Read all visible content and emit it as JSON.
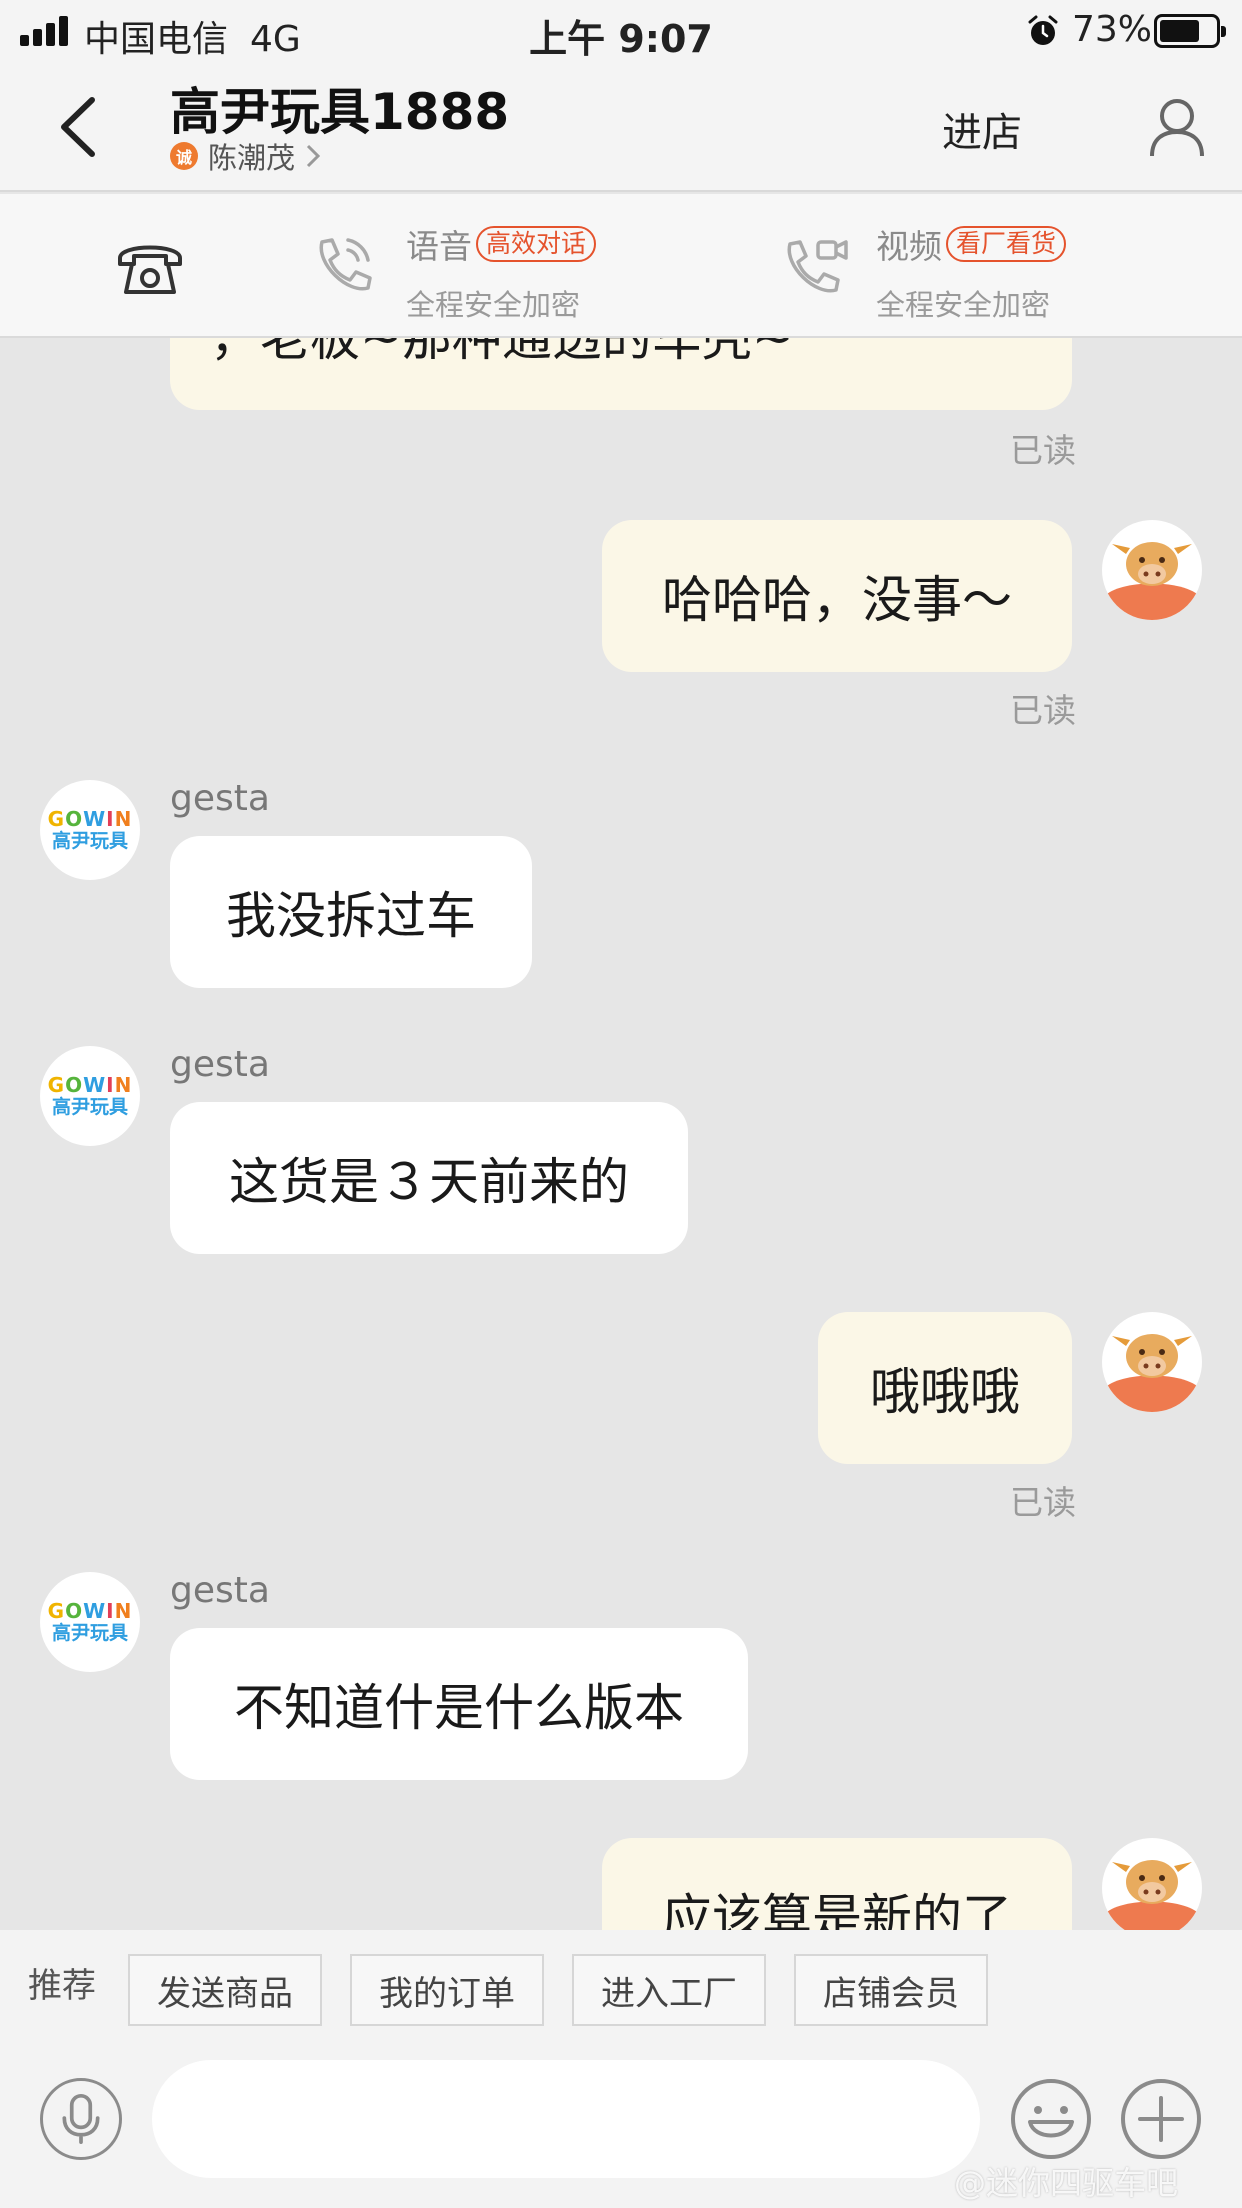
{
  "status_bar": {
    "carrier": "中国电信",
    "network": "4G",
    "time": "上午 9:07",
    "battery_percent": "73%",
    "battery_level": 0.73
  },
  "header": {
    "shop_name": "高尹玩具1888",
    "badge_char": "诚",
    "contact_name": "陈潮茂",
    "enter_store": "进店"
  },
  "call_bar": {
    "voice": {
      "title": "语音",
      "tag": "高效对话",
      "subtitle": "全程安全加密"
    },
    "video": {
      "title": "视频",
      "tag": "看厂看货",
      "subtitle": "全程安全加密"
    }
  },
  "messages": [
    {
      "from": "me",
      "text": "，老板~那种通透的车壳~",
      "read": "已读"
    },
    {
      "from": "me",
      "text": "哈哈哈，没事～",
      "read": "已读"
    },
    {
      "from": "them",
      "sender": "gesta",
      "text": "我没拆过车"
    },
    {
      "from": "them",
      "sender": "gesta",
      "text": "这货是３天前来的"
    },
    {
      "from": "me",
      "text": "哦哦哦",
      "read": "已读"
    },
    {
      "from": "them",
      "sender": "gesta",
      "text": "不知道什是什么版本"
    },
    {
      "from": "me",
      "text": "应该算是新的了"
    }
  ],
  "shop_avatar": {
    "logo_text": "GOWIN",
    "logo_cn": "高尹玩具"
  },
  "suggestions": {
    "label": "推荐",
    "items": [
      "发送商品",
      "我的订单",
      "进入工厂",
      "店铺会员"
    ]
  },
  "input": {
    "value": ""
  },
  "watermark": "@迷你四驱车吧",
  "colors": {
    "my_bubble": "#fbf7e7",
    "their_bubble": "#ffffff",
    "accent_orange": "#e5532d",
    "chat_bg": "#e6e6e6"
  }
}
